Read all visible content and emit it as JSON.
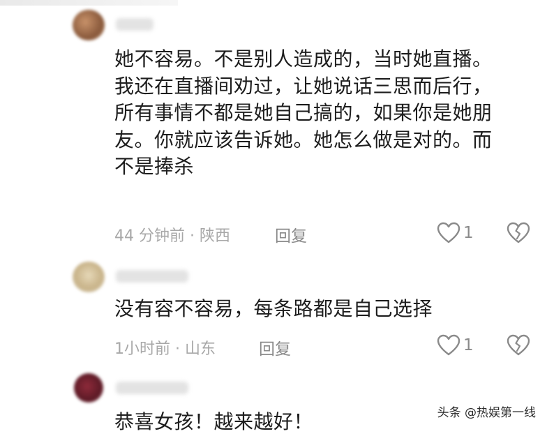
{
  "comments": [
    {
      "text_lines": [
        "她不容易。不是别人造成的，当时她直播。",
        "我还在直播间劝过，让她说话三思而后行，",
        "所有事情不都是她自己搞的，如果你是她朋",
        "友。你就应该告诉她。她怎么做是对的。而",
        "不是捧杀"
      ],
      "meta": "44 分钟前 · 陕西",
      "reply_label": "回复",
      "like_count": "1"
    },
    {
      "text_lines": [
        "没有容不容易，每条路都是自己选择"
      ],
      "meta": "1小时前 · 山东",
      "reply_label": "回复",
      "like_count": "1"
    },
    {
      "text_lines": [
        "恭喜女孩！越来越好！"
      ]
    }
  ],
  "icons": {
    "like": "heart-outline-icon",
    "dislike": "broken-heart-icon"
  },
  "watermark": "头条 @热娱第一线",
  "colors": {
    "text": "#1d1d1d",
    "meta": "#a8a8a8",
    "action": "#8a8a8a"
  }
}
